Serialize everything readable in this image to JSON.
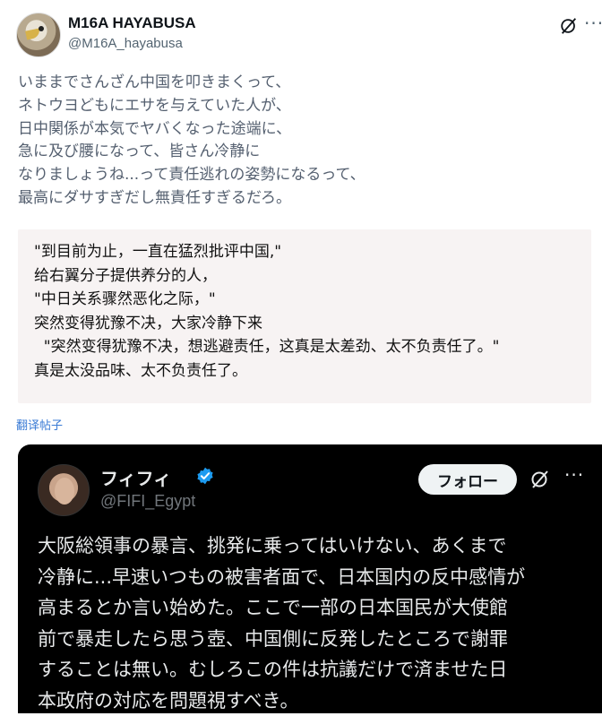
{
  "author": {
    "name": "M16A HAYABUSA",
    "handle": "@M16A_hayabusa",
    "avatar_icon": "falcon-avatar"
  },
  "post": {
    "text": "いままでさんざん中国を叩きまくって、\nネトウヨどもにエサを与えていた人が、\n日中関係が本気でヤバくなった途端に、\n急に及び腰になって、皆さん冷静に\nなりましょうね...って責任逃れの姿勢になるって、\n最高にダサすぎだし無責任すぎるだろ。"
  },
  "translation": {
    "text": "\"到目前为止，一直在猛烈批评中国,\"\n给右翼分子提供养分的人，\n\"中日关系骤然恶化之际，\"\n突然变得犹豫不决，大家冷静下来\n  \"突然变得犹豫不决，想逃避责任，这真是太差劲、太不负责任了。\"\n真是太没品味、太不负责任了。",
    "link_label": "翻译帖子"
  },
  "quoted": {
    "name": "フィフィ",
    "handle": "@FIFI_Egypt",
    "follow_label": "フォロー",
    "text": "大阪総領事の暴言、挑発に乗ってはいけない、あくまで\n冷静に...早速いつもの被害者面で、日本国内の反中感情が\n高まるとか言い始めた。ここで一部の日本国民が大使館\n前で暴走したら思う壺、中国側に反発したところで謝罪\nすることは無い。むしろこの件は抗議だけで済ませた日\n本政府の対応を問題視すべき。",
    "verified_color": "#1d9bf0"
  },
  "icons": {
    "grok": "grok-icon",
    "more": "more-icon",
    "verified": "verified-badge-icon"
  },
  "colors": {
    "background": "#ffffff",
    "quote_background": "#000000",
    "link": "#3a7bd5"
  }
}
